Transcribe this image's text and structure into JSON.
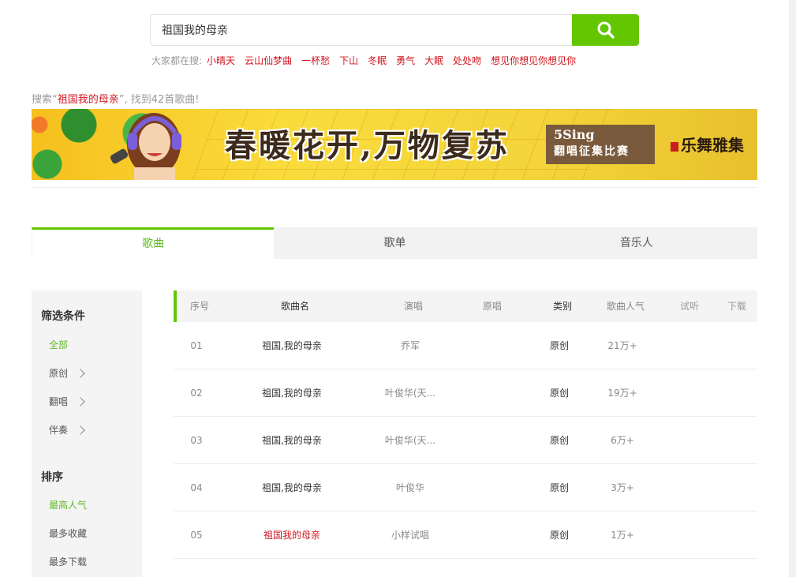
{
  "search": {
    "value": "祖国我的母亲",
    "button_icon": "search-icon"
  },
  "hot": {
    "label": "大家都在搜:",
    "items": [
      "小晴天",
      "云山仙梦曲",
      "一杯愁",
      "下山",
      "冬眠",
      "勇气",
      "大眠",
      "处处吻",
      "想见你想见你想见你"
    ]
  },
  "result": {
    "prefix": "搜索“",
    "keyword": "祖国我的母亲",
    "suffix": "”, 找到42首歌曲!"
  },
  "banner": {
    "title": "春暖花开,万物复苏",
    "box_line1": "5Sing",
    "box_line2": "翻唱征集比赛",
    "logo": "乐舞雅集"
  },
  "tabs": [
    {
      "label": "歌曲",
      "active": true
    },
    {
      "label": "歌单",
      "active": false
    },
    {
      "label": "音乐人",
      "active": false
    }
  ],
  "sidebar": {
    "filter_title": "筛选条件",
    "filters": [
      {
        "label": "全部",
        "active": true,
        "arrow": false
      },
      {
        "label": "原创",
        "active": false,
        "arrow": true
      },
      {
        "label": "翻唱",
        "active": false,
        "arrow": true
      },
      {
        "label": "伴奏",
        "active": false,
        "arrow": true
      }
    ],
    "sort_title": "排序",
    "sorts": [
      {
        "label": "最高人气",
        "active": true
      },
      {
        "label": "最多收藏",
        "active": false
      },
      {
        "label": "最多下载",
        "active": false
      }
    ]
  },
  "table": {
    "headers": [
      "序号",
      "歌曲名",
      "演唱",
      "原唱",
      "类别",
      "歌曲人气",
      "试听",
      "下载"
    ],
    "rows": [
      {
        "num": "01",
        "name": "祖国,我的母亲",
        "singer": "乔军",
        "orig": "",
        "type": "原创",
        "pop": "21万+",
        "highlight": false
      },
      {
        "num": "02",
        "name": "祖国,我的母亲",
        "singer": "叶俊华(天...",
        "orig": "",
        "type": "原创",
        "pop": "19万+",
        "highlight": false
      },
      {
        "num": "03",
        "name": "祖国,我的母亲",
        "singer": "叶俊华(天...",
        "orig": "",
        "type": "原创",
        "pop": "6万+",
        "highlight": false
      },
      {
        "num": "04",
        "name": "祖国,我的母亲",
        "singer": "叶俊华",
        "orig": "",
        "type": "原创",
        "pop": "3万+",
        "highlight": false
      },
      {
        "num": "05",
        "name": "祖国我的母亲",
        "singer": "小样试唱",
        "orig": "",
        "type": "原创",
        "pop": "1万+",
        "highlight": true
      }
    ],
    "play_icon": "play-icon",
    "download_icon": "download-icon"
  },
  "colors": {
    "accent": "#63c600",
    "keyword": "#d2141e"
  }
}
